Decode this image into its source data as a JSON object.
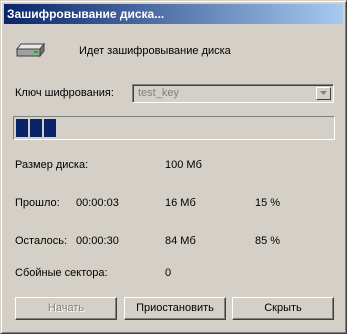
{
  "window": {
    "title": "Зашифровывание диска..."
  },
  "status": {
    "icon": "disk-drive-icon",
    "text": "Идет зашифровывание диска"
  },
  "key": {
    "label": "Ключ шифрования:",
    "value": "test_key"
  },
  "progress": {
    "percent": 15
  },
  "stats": {
    "disk_size_label": "Размер диска:",
    "disk_size_value": "100 Мб",
    "elapsed_label": "Прошло:",
    "elapsed_time": "00:00:03",
    "elapsed_mb": "16 Мб",
    "elapsed_pct": "15 %",
    "remaining_label": "Осталось:",
    "remaining_time": "00:00:30",
    "remaining_mb": "84 Мб",
    "remaining_pct": "85 %",
    "bad_sectors_label": "Сбойные сектора:",
    "bad_sectors_value": "0"
  },
  "buttons": {
    "start": "Начать",
    "pause": "Приостановить",
    "hide": "Скрыть"
  },
  "colors": {
    "title_gradient_start": "#0a246a",
    "title_gradient_end": "#a6caf0",
    "progress_fill": "#0a246a",
    "dialog_face": "#d4d0c8"
  }
}
